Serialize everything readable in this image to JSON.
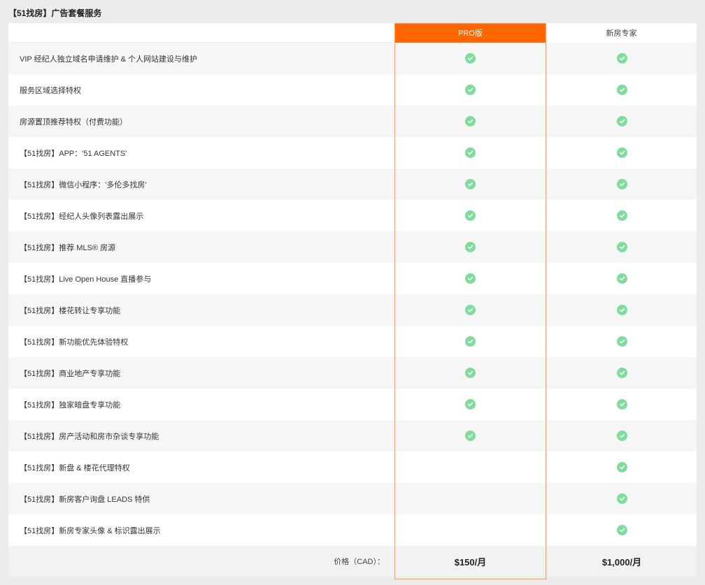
{
  "title": "【51找房】广告套餐服务",
  "columns": {
    "pro": "PRO版",
    "expert": "新房专家"
  },
  "features": [
    {
      "label": "VIP 经纪人独立域名申请维护 & 个人网站建设与维护",
      "pro": true,
      "expert": true
    },
    {
      "label": "服务区域选择特权",
      "pro": true,
      "expert": true
    },
    {
      "label": "房源置顶推荐特权（付费功能）",
      "pro": true,
      "expert": true
    },
    {
      "label": "【51找房】APP：'51 AGENTS'",
      "pro": true,
      "expert": true
    },
    {
      "label": "【51找房】微信小程序：'多伦多找房'",
      "pro": true,
      "expert": true
    },
    {
      "label": "【51找房】经纪人头像列表露出展示",
      "pro": true,
      "expert": true
    },
    {
      "label": "【51找房】推荐 MLS® 房源",
      "pro": true,
      "expert": true
    },
    {
      "label": "【51找房】Live Open House 直播参与",
      "pro": true,
      "expert": true
    },
    {
      "label": "【51找房】楼花转让专享功能",
      "pro": true,
      "expert": true
    },
    {
      "label": "【51找房】新功能优先体验特权",
      "pro": true,
      "expert": true
    },
    {
      "label": "【51找房】商业地产专享功能",
      "pro": true,
      "expert": true
    },
    {
      "label": "【51找房】独家暗盘专享功能",
      "pro": true,
      "expert": true
    },
    {
      "label": "【51找房】房产活动和房市杂谈专享功能",
      "pro": true,
      "expert": true
    },
    {
      "label": "【51找房】新盘 & 楼花代理特权",
      "pro": false,
      "expert": true
    },
    {
      "label": "【51找房】新房客户询盘 LEADS 特供",
      "pro": false,
      "expert": true
    },
    {
      "label": "【51找房】新房专家头像 & 标识露出展示",
      "pro": false,
      "expert": true
    }
  ],
  "price": {
    "label": "价格（CAD）：",
    "pro": "$150/月",
    "expert": "$1,000/月"
  },
  "colors": {
    "accent": "#ff6600",
    "check": "#7fdc9c",
    "frame": "#ff9a55"
  },
  "icons": {
    "check": "check-circle-icon"
  }
}
